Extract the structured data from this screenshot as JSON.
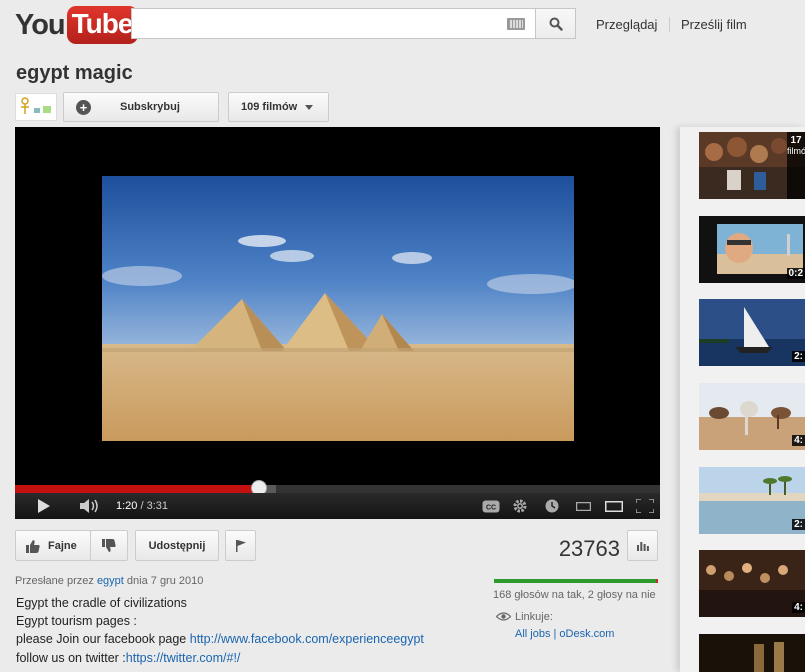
{
  "header": {
    "logo_you": "You",
    "logo_tube": "Tube",
    "search": {
      "value": "",
      "placeholder": ""
    },
    "nav": {
      "browse": "Przeglądaj",
      "upload": "Prześlij film"
    }
  },
  "channel": {
    "title": "egypt magic",
    "subscribe_label": "Subskrybuj",
    "videos_label": "109 filmów"
  },
  "player": {
    "time_current": "1:20",
    "time_total": "3:31",
    "progress_fraction": 0.379,
    "buffer_fraction": 0.404
  },
  "actions": {
    "like_label": "Fajne",
    "share_label": "Udostępnij",
    "views": "23763"
  },
  "rating": {
    "like_fraction": 0.988,
    "votes_text": "168 głosów na tak, 2 głosy na nie"
  },
  "links": {
    "label": "Linkuje:",
    "value": "All jobs | oDesk.com"
  },
  "uploaded": {
    "prefix": "Przesłane przez ",
    "user": "egypt",
    "suffix": " dnia 7 gru 2010"
  },
  "description": {
    "line1": "Egypt the cradle of civilizations",
    "line2": "Egypt tourism pages :",
    "line3_text": "please Join our facebook page ",
    "line3_link": "http://www.facebook.com/experienceegypt",
    "line4_text": "follow us on twitter :",
    "line4_link": "https://twitter.com/#!/"
  },
  "playlist": {
    "first_count": "17",
    "first_count_label": "filmó",
    "durations": [
      "0:2",
      "2:",
      "4:",
      "2:",
      "4:"
    ]
  },
  "colors": {
    "brand_red": "#c4302b",
    "progress_red": "#c4110f",
    "link_blue": "#1a65b0",
    "like_green": "#2c9a2c"
  }
}
